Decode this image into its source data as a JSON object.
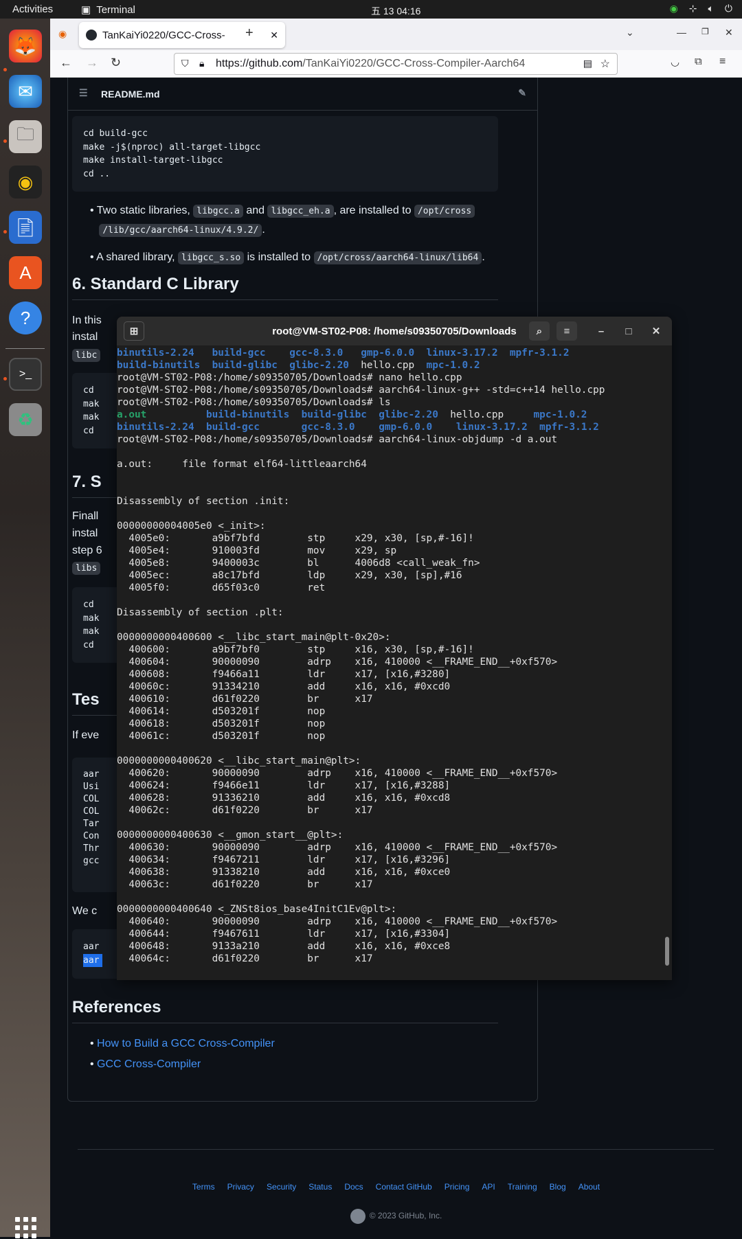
{
  "topbar": {
    "activities": "Activities",
    "app": "Terminal",
    "clock": "五 13 04:16"
  },
  "browser": {
    "tab_title": "TanKaiYi0220/GCC-Cross-",
    "url_prefix": "https://github.com",
    "url_path": "/TanKaiYi0220/GCC-Cross-Compiler-Aarch64"
  },
  "readme": {
    "filename": "README.md",
    "code1": [
      "cd build-gcc",
      "make -j$(nproc) all-target-libgcc",
      "make install-target-libgcc",
      "cd .."
    ],
    "b1_a": "Two static libraries, ",
    "b1_c1": "libgcc.a",
    "b1_b": " and ",
    "b1_c2": "libgcc_eh.a",
    "b1_c": ", are installed to ",
    "b1_c3": "/opt/cross",
    "b1_c4": "/lib/gcc/aarch64-linux/4.9.2/",
    "b1_d": ".",
    "b2_a": "A shared library, ",
    "b2_c1": "libgcc_s.so",
    "b2_b": " is installed to ",
    "b2_c2": "/opt/cross/aarch64-linux/lib64",
    "b2_d": ".",
    "h6": "6. Standard C Library",
    "p6a": "In this",
    "p6b": "instal",
    "p6c": "libc",
    "code2": [
      "cd",
      "mak",
      "mak",
      "cd"
    ],
    "h7": "7. S",
    "p7": [
      "Finall",
      "instal",
      "step 6",
      "libs"
    ],
    "code3": [
      "cd",
      "mak",
      "mak",
      "cd"
    ],
    "htest": "Tes",
    "ptest": "If eve",
    "code4": [
      "aar",
      "Usi",
      "COL",
      "COL",
      "Tar",
      "Con",
      "Thr",
      "gcc"
    ],
    "pwe": "We c",
    "code5": [
      "aar",
      "aar"
    ],
    "href": "References",
    "ref1": "How to Build a GCC Cross-Compiler",
    "ref2": "GCC Cross-Compiler"
  },
  "footer": {
    "links": [
      "Terms",
      "Privacy",
      "Security",
      "Status",
      "Docs",
      "Contact GitHub",
      "Pricing",
      "API",
      "Training",
      "Blog",
      "About"
    ],
    "copyright": "© 2023 GitHub, Inc."
  },
  "terminal": {
    "title": "root@VM-ST02-P08: /home/s09350705/Downloads",
    "lines": [
      [
        {
          "t": "binutils-2.24   ",
          "c": "bl"
        },
        {
          "t": "build-gcc    ",
          "c": "bl"
        },
        {
          "t": "gcc-8.3.0   ",
          "c": "bl"
        },
        {
          "t": "gmp-6.0.0  ",
          "c": "bl"
        },
        {
          "t": "linux-3.17.2  ",
          "c": "bl"
        },
        {
          "t": "mpfr-3.1.2",
          "c": "bl"
        }
      ],
      [
        {
          "t": "build-binutils  ",
          "c": "bl"
        },
        {
          "t": "build-glibc  ",
          "c": "bl"
        },
        {
          "t": "glibc-2.20  ",
          "c": "bl"
        },
        {
          "t": "hello.cpp  ",
          "c": ""
        },
        {
          "t": "mpc-1.0.2",
          "c": "bl"
        }
      ],
      [
        {
          "t": "root@VM-ST02-P08:/home/s09350705/Downloads# nano hello.cpp",
          "c": ""
        }
      ],
      [
        {
          "t": "root@VM-ST02-P08:/home/s09350705/Downloads# aarch64-linux-g++ -std=c++14 hello.cpp",
          "c": ""
        }
      ],
      [
        {
          "t": "root@VM-ST02-P08:/home/s09350705/Downloads# ls",
          "c": ""
        }
      ],
      [
        {
          "t": "a.out          ",
          "c": "gr"
        },
        {
          "t": "build-binutils  ",
          "c": "bl"
        },
        {
          "t": "build-glibc  ",
          "c": "bl"
        },
        {
          "t": "glibc-2.20  ",
          "c": "bl"
        },
        {
          "t": "hello.cpp     ",
          "c": ""
        },
        {
          "t": "mpc-1.0.2",
          "c": "bl"
        }
      ],
      [
        {
          "t": "binutils-2.24  ",
          "c": "bl"
        },
        {
          "t": "build-gcc       ",
          "c": "bl"
        },
        {
          "t": "gcc-8.3.0    ",
          "c": "bl"
        },
        {
          "t": "gmp-6.0.0    ",
          "c": "bl"
        },
        {
          "t": "linux-3.17.2  ",
          "c": "bl"
        },
        {
          "t": "mpfr-3.1.2",
          "c": "bl"
        }
      ],
      [
        {
          "t": "root@VM-ST02-P08:/home/s09350705/Downloads# aarch64-linux-objdump -d a.out",
          "c": ""
        }
      ],
      [
        {
          "t": "",
          "c": ""
        }
      ],
      [
        {
          "t": "a.out:     file format elf64-littleaarch64",
          "c": ""
        }
      ],
      [
        {
          "t": "",
          "c": ""
        }
      ],
      [
        {
          "t": "",
          "c": ""
        }
      ],
      [
        {
          "t": "Disassembly of section .init:",
          "c": ""
        }
      ],
      [
        {
          "t": "",
          "c": ""
        }
      ],
      [
        {
          "t": "00000000004005e0 <_init>:",
          "c": ""
        }
      ],
      [
        {
          "t": "  4005e0:       a9bf7bfd        stp     x29, x30, [sp,#-16]!",
          "c": ""
        }
      ],
      [
        {
          "t": "  4005e4:       910003fd        mov     x29, sp",
          "c": ""
        }
      ],
      [
        {
          "t": "  4005e8:       9400003c        bl      4006d8 <call_weak_fn>",
          "c": ""
        }
      ],
      [
        {
          "t": "  4005ec:       a8c17bfd        ldp     x29, x30, [sp],#16",
          "c": ""
        }
      ],
      [
        {
          "t": "  4005f0:       d65f03c0        ret",
          "c": ""
        }
      ],
      [
        {
          "t": "",
          "c": ""
        }
      ],
      [
        {
          "t": "Disassembly of section .plt:",
          "c": ""
        }
      ],
      [
        {
          "t": "",
          "c": ""
        }
      ],
      [
        {
          "t": "0000000000400600 <__libc_start_main@plt-0x20>:",
          "c": ""
        }
      ],
      [
        {
          "t": "  400600:       a9bf7bf0        stp     x16, x30, [sp,#-16]!",
          "c": ""
        }
      ],
      [
        {
          "t": "  400604:       90000090        adrp    x16, 410000 <__FRAME_END__+0xf570>",
          "c": ""
        }
      ],
      [
        {
          "t": "  400608:       f9466a11        ldr     x17, [x16,#3280]",
          "c": ""
        }
      ],
      [
        {
          "t": "  40060c:       91334210        add     x16, x16, #0xcd0",
          "c": ""
        }
      ],
      [
        {
          "t": "  400610:       d61f0220        br      x17",
          "c": ""
        }
      ],
      [
        {
          "t": "  400614:       d503201f        nop",
          "c": ""
        }
      ],
      [
        {
          "t": "  400618:       d503201f        nop",
          "c": ""
        }
      ],
      [
        {
          "t": "  40061c:       d503201f        nop",
          "c": ""
        }
      ],
      [
        {
          "t": "",
          "c": ""
        }
      ],
      [
        {
          "t": "0000000000400620 <__libc_start_main@plt>:",
          "c": ""
        }
      ],
      [
        {
          "t": "  400620:       90000090        adrp    x16, 410000 <__FRAME_END__+0xf570>",
          "c": ""
        }
      ],
      [
        {
          "t": "  400624:       f9466e11        ldr     x17, [x16,#3288]",
          "c": ""
        }
      ],
      [
        {
          "t": "  400628:       91336210        add     x16, x16, #0xcd8",
          "c": ""
        }
      ],
      [
        {
          "t": "  40062c:       d61f0220        br      x17",
          "c": ""
        }
      ],
      [
        {
          "t": "",
          "c": ""
        }
      ],
      [
        {
          "t": "0000000000400630 <__gmon_start__@plt>:",
          "c": ""
        }
      ],
      [
        {
          "t": "  400630:       90000090        adrp    x16, 410000 <__FRAME_END__+0xf570>",
          "c": ""
        }
      ],
      [
        {
          "t": "  400634:       f9467211        ldr     x17, [x16,#3296]",
          "c": ""
        }
      ],
      [
        {
          "t": "  400638:       91338210        add     x16, x16, #0xce0",
          "c": ""
        }
      ],
      [
        {
          "t": "  40063c:       d61f0220        br      x17",
          "c": ""
        }
      ],
      [
        {
          "t": "",
          "c": ""
        }
      ],
      [
        {
          "t": "0000000000400640 <_ZNSt8ios_base4InitC1Ev@plt>:",
          "c": ""
        }
      ],
      [
        {
          "t": "  400640:       90000090        adrp    x16, 410000 <__FRAME_END__+0xf570>",
          "c": ""
        }
      ],
      [
        {
          "t": "  400644:       f9467611        ldr     x17, [x16,#3304]",
          "c": ""
        }
      ],
      [
        {
          "t": "  400648:       9133a210        add     x16, x16, #0xce8",
          "c": ""
        }
      ],
      [
        {
          "t": "  40064c:       d61f0220        br      x17",
          "c": ""
        }
      ]
    ]
  }
}
